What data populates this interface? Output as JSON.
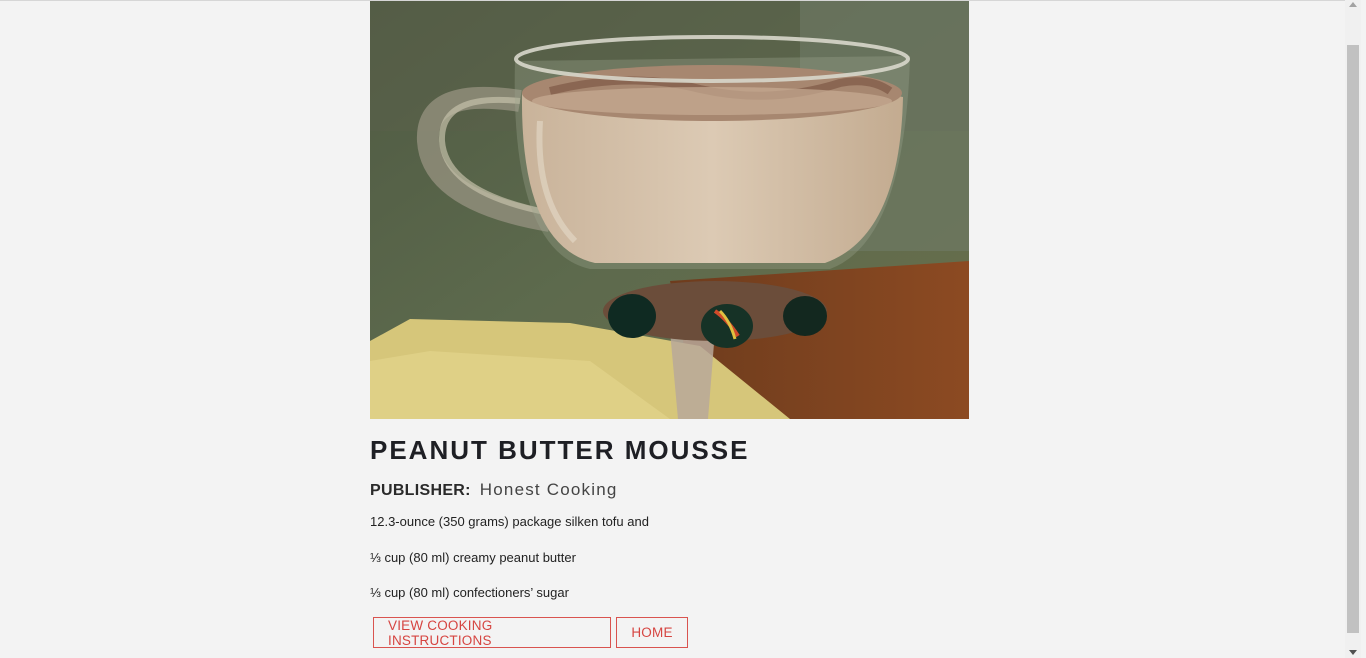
{
  "recipe": {
    "image_alt": "Peanut butter mousse in a glass cup",
    "title": "PEANUT BUTTER MOUSSE",
    "publisher_label": "PUBLISHER:",
    "publisher_name": "Honest Cooking",
    "ingredients": [
      "12.3-ounce (350 grams) package silken tofu and",
      "⅓ cup (80 ml) creamy peanut butter",
      "⅓ cup (80 ml) confectioners’ sugar"
    ]
  },
  "actions": {
    "view_instructions_label": "VIEW COOKING INSTRUCTIONS",
    "home_label": "HOME"
  },
  "colors": {
    "background": "#f3f3f3",
    "accent": "#d64541",
    "title": "#1e1f24"
  }
}
